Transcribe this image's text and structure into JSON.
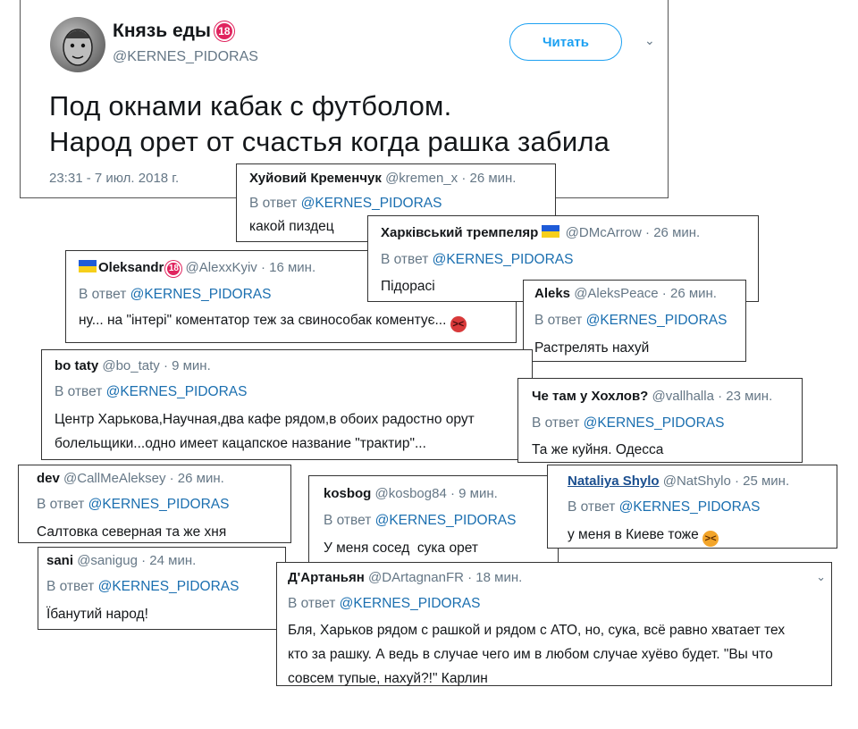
{
  "main": {
    "name": "Князь еды",
    "badge": "18",
    "handle": "@KERNES_PIDORAS",
    "follow_label": "Читать",
    "caret": "⌄",
    "text_line1": "Под окнами кабак с футболом.",
    "text_line2": "Народ орет от счастья когда рашка забила",
    "time": "23:31 - 7 июл. 2018 г."
  },
  "reply_prefix": "В ответ ",
  "reply_mention": "@KERNES_PIDORAS",
  "replies": [
    {
      "name": "Хуйовий Кременчук",
      "handle": "@kremen_x · 26 мин.",
      "text": "какой пиздец"
    },
    {
      "name": "Харківський тремпеляр",
      "handle": "@DMcArrow · 26 мин.",
      "text": "Підорасі"
    },
    {
      "name": "Oleksandr",
      "badge": "18",
      "handle": "@AlexxKyiv · 16 мин.",
      "text": "ну... на \"інтері\" коментатор теж за свинособак коментує..."
    },
    {
      "name": "Aleks",
      "handle": "@AleksPeace · 26 мин.",
      "text": "Растрелять нахуй"
    },
    {
      "name": "bo taty",
      "handle": "@bo_taty · 9 мин.",
      "text_line1": "Центр Харькова,Научная,два кафе рядом,в обоих радостно орут",
      "text_line2": "болельщики...одно имеет кацапское название \"трактир\"..."
    },
    {
      "name": "Че там у Хохлов?",
      "handle": "@vallhalla · 23 мин.",
      "text": "Та же куйня. Одесса"
    },
    {
      "name": "dev",
      "handle": "@CallMeAleksey · 26 мин.",
      "text": "Салтовка северная та же хня"
    },
    {
      "name": "kosbog",
      "handle": "@kosbog84 · 9 мин.",
      "text": "У меня сосед  сука орет"
    },
    {
      "name": "Nataliya Shylo",
      "handle": "@NatShylo · 25 мин.",
      "text": "у меня в Киеве тоже"
    },
    {
      "name": "sani",
      "handle": "@sanigug · 24 мин.",
      "text": "Їбанутий народ!"
    },
    {
      "name": "Д'Артаньян",
      "handle": "@DArtagnanFR · 18 мин.",
      "text_line1": "Бля, Харьков рядом с рашкой и рядом с АТО, но, сука, всё равно хватает тех",
      "text_line2": "кто за рашку. А ведь в случае чего им в любом случае хуёво будет. \"Вы что",
      "text_line3": "совсем тупые, нахуй?!\" Карлин"
    }
  ],
  "colors": {
    "link": "#1b6fb0",
    "muted": "#657786",
    "accent": "#1da1f2"
  }
}
